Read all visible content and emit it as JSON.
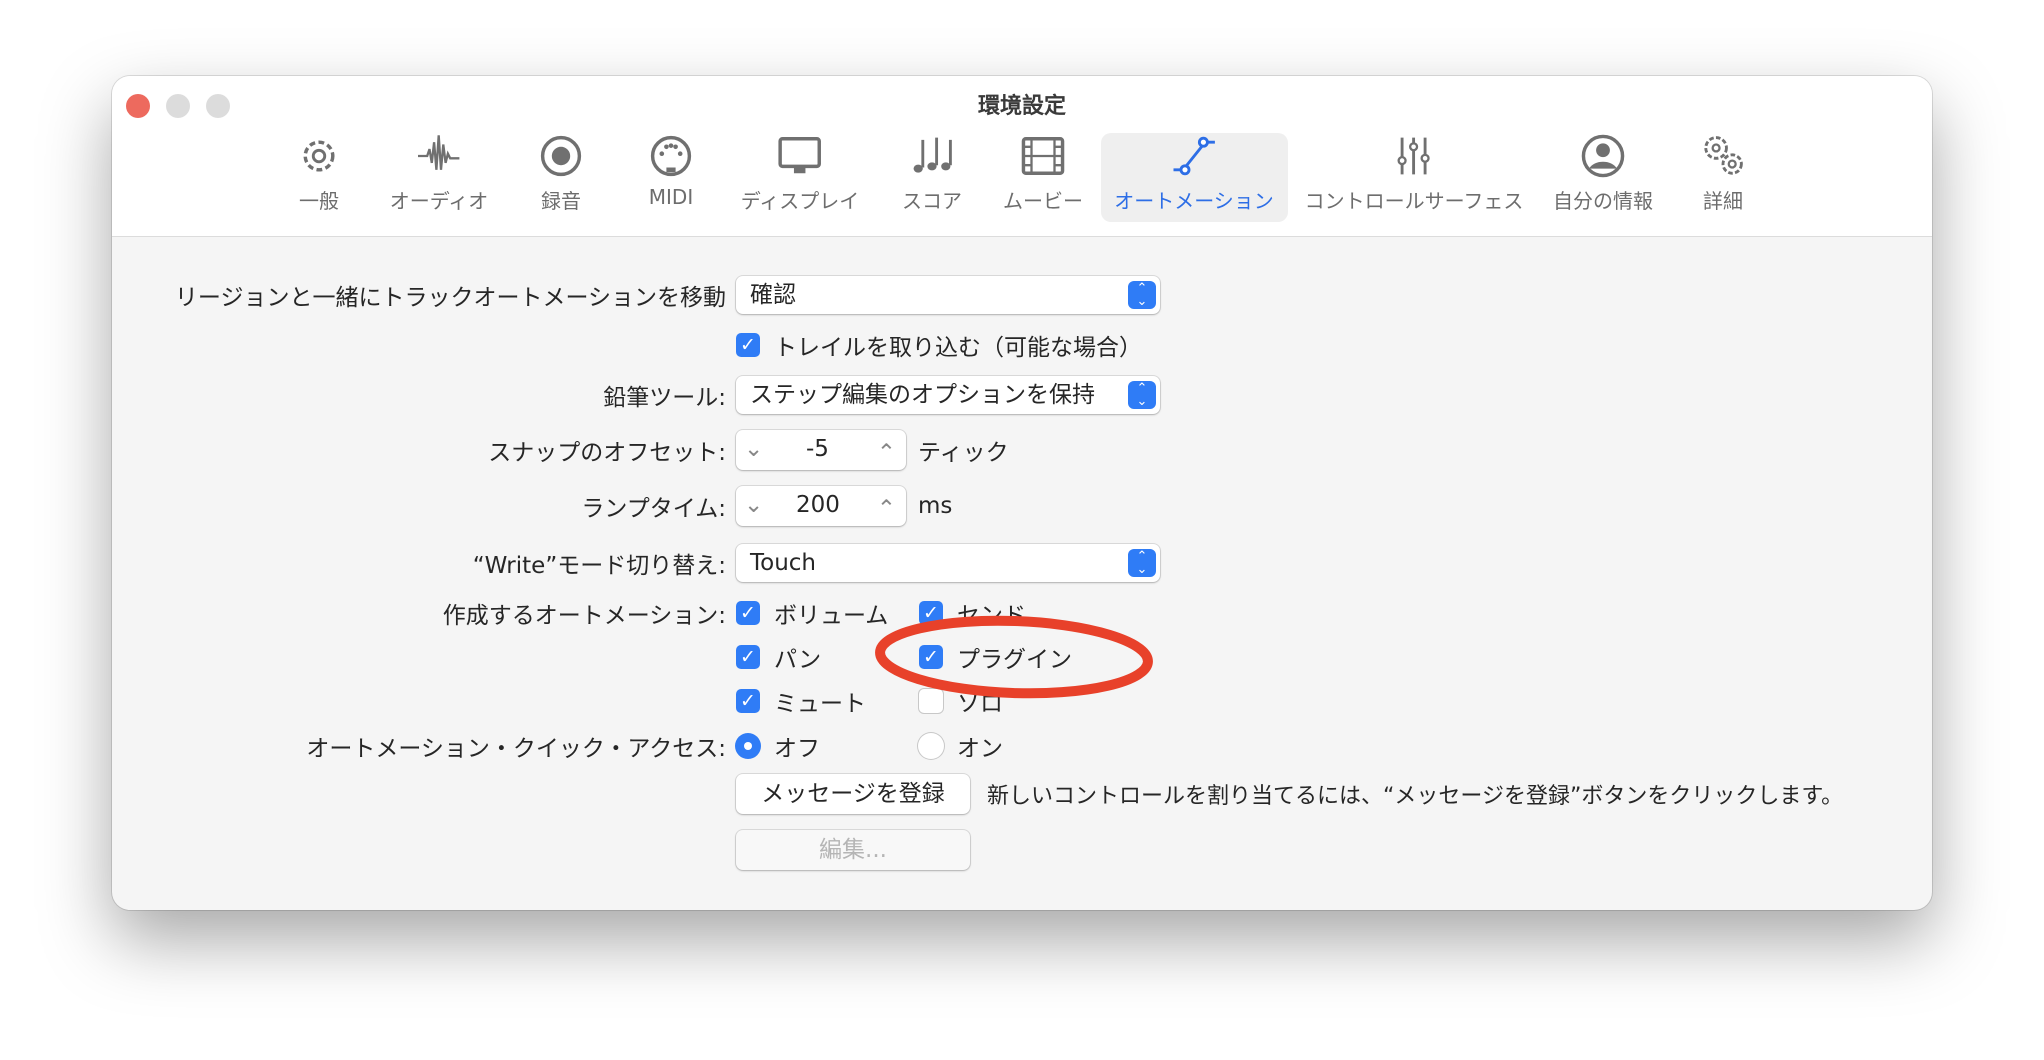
{
  "window": {
    "title": "環境設定"
  },
  "toolbar": [
    {
      "label": "一般",
      "icon": "gear-icon"
    },
    {
      "label": "オーディオ",
      "icon": "waveform-icon"
    },
    {
      "label": "録音",
      "icon": "record-icon"
    },
    {
      "label": "MIDI",
      "icon": "midi-icon"
    },
    {
      "label": "ディスプレイ",
      "icon": "display-icon"
    },
    {
      "label": "スコア",
      "icon": "notes-icon"
    },
    {
      "label": "ムービー",
      "icon": "film-icon"
    },
    {
      "label": "オートメーション",
      "icon": "automation-icon",
      "selected": true
    },
    {
      "label": "コントロールサーフェス",
      "icon": "sliders-icon"
    },
    {
      "label": "自分の情報",
      "icon": "person-icon"
    },
    {
      "label": "詳細",
      "icon": "gears-icon"
    }
  ],
  "form": {
    "move_automation": {
      "label": "リージョンと一緒にトラックオートメーションを移動",
      "value": "確認"
    },
    "trail": {
      "label": "トレイルを取り込む（可能な場合）",
      "checked": true
    },
    "pencil": {
      "label": "鉛筆ツール:",
      "value": "ステップ編集のオプションを保持"
    },
    "snap_offset": {
      "label": "スナップのオフセット:",
      "value": "-5",
      "unit": "ティック"
    },
    "ramp_time": {
      "label": "ランプタイム:",
      "value": "200",
      "unit": "ms"
    },
    "write_mode": {
      "label": "“Write”モード切り替え:",
      "value": "Touch"
    },
    "create": {
      "label": "作成するオートメーション:",
      "items": [
        {
          "label": "ボリューム",
          "checked": true
        },
        {
          "label": "センド",
          "checked": true
        },
        {
          "label": "パン",
          "checked": true
        },
        {
          "label": "プラグイン",
          "checked": true
        },
        {
          "label": "ミュート",
          "checked": true
        },
        {
          "label": "ソロ",
          "checked": false
        }
      ]
    },
    "quick_access": {
      "label": "オートメーション・クイック・アクセス:",
      "options": [
        "オフ",
        "オン"
      ],
      "selected": "オフ"
    },
    "learn_button": "メッセージを登録",
    "learn_help": "新しいコントロールを割り当てるには、“メッセージを登録”ボタンをクリックします。",
    "edit_button": "編集..."
  },
  "annotation_color": "#e8412a"
}
